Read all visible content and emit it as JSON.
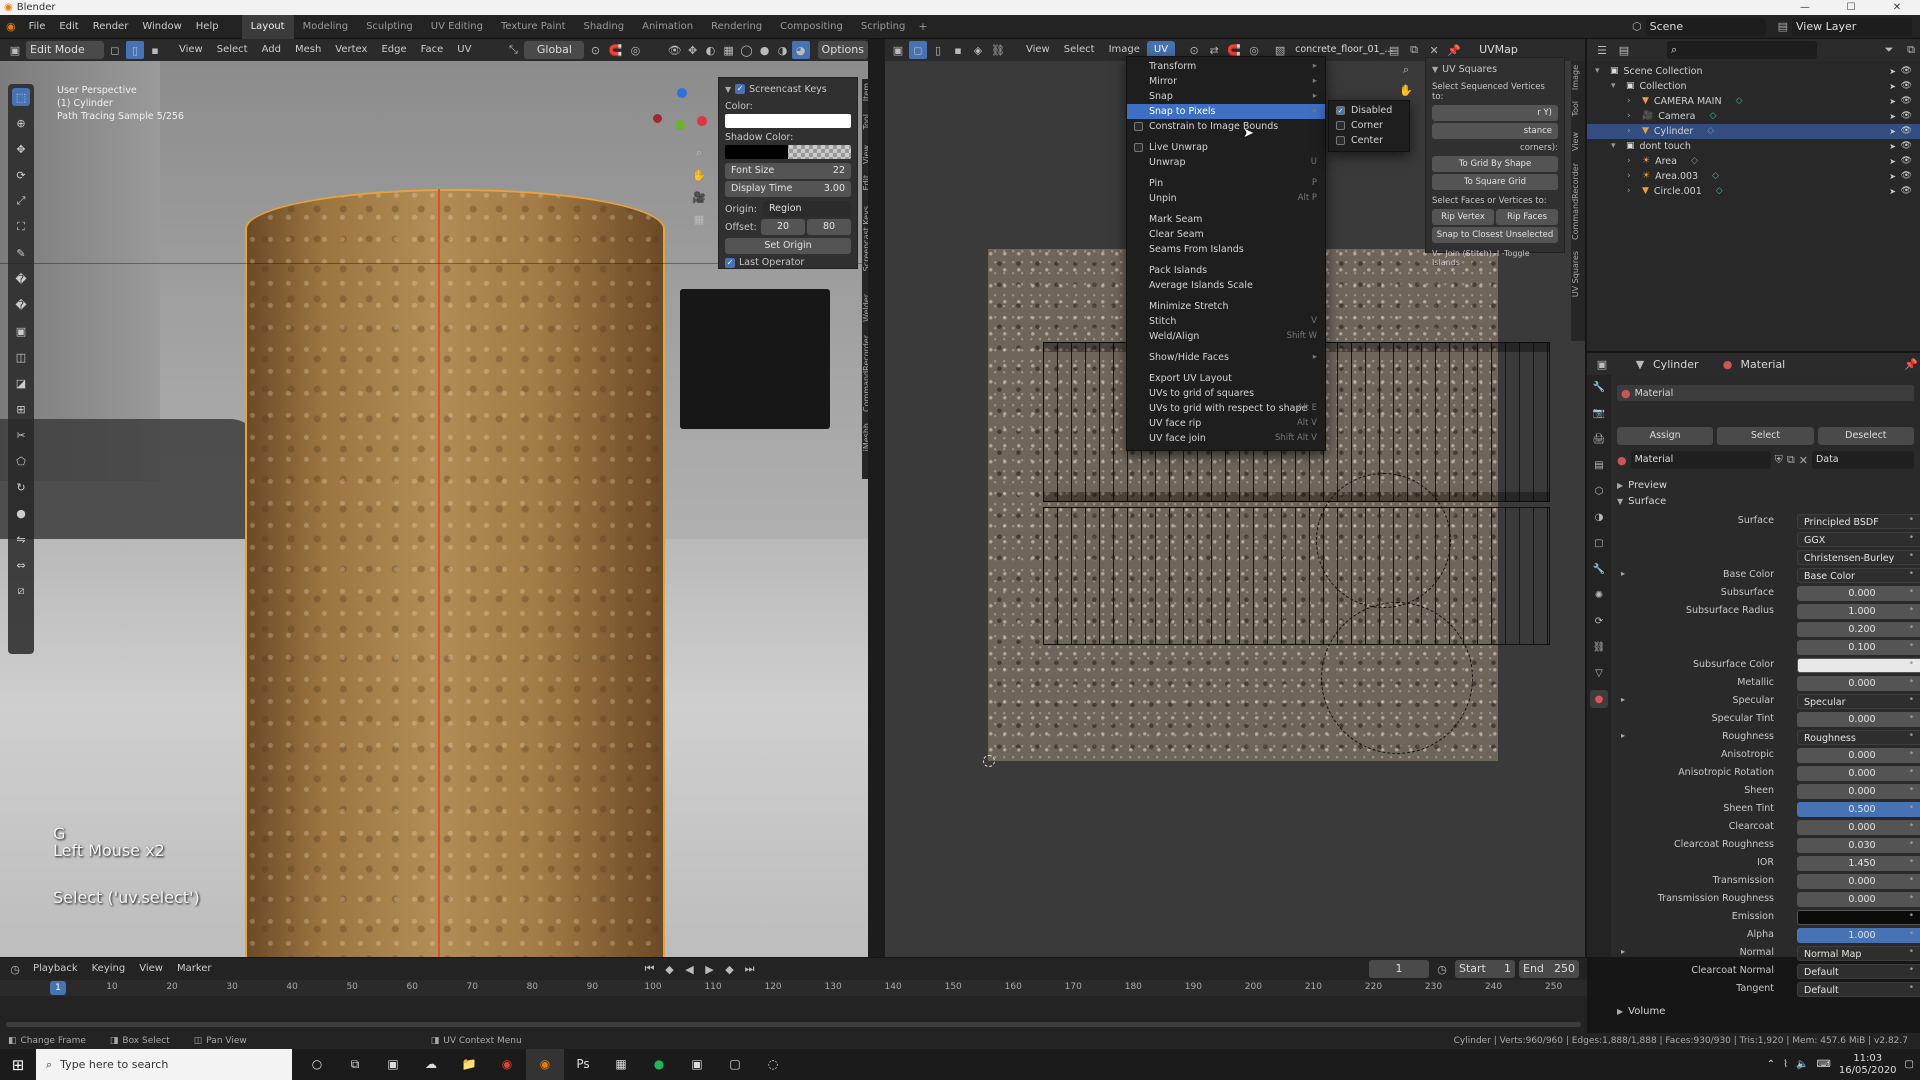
{
  "title_bar": {
    "app": "Blender"
  },
  "top_menu": [
    "File",
    "Edit",
    "Render",
    "Window",
    "Help"
  ],
  "workspaces": [
    "Layout",
    "Modeling",
    "Sculpting",
    "UV Editing",
    "Texture Paint",
    "Shading",
    "Animation",
    "Rendering",
    "Compositing",
    "Scripting"
  ],
  "active_workspace": "Layout",
  "scene": "Scene",
  "view_layer": "View Layer",
  "viewport": {
    "mode": "Edit Mode",
    "menus": [
      "View",
      "Select",
      "Add",
      "Mesh",
      "Vertex",
      "Edge",
      "Face",
      "UV"
    ],
    "orientation": "Global",
    "options_label": "Options",
    "overlay_text": [
      "User Perspective",
      "(1) Cylinder",
      "Path Tracing Sample 5/256"
    ],
    "key_big": "G",
    "key_small": "Left Mouse x2",
    "operator_text": "Select ('uv.select')",
    "side_tabs": [
      "Item",
      "Tool",
      "View",
      "Edit",
      "Screencast Keys",
      "Welder",
      "CommandRecorder",
      "iMeshh"
    ],
    "screencast_panel": {
      "title": "Screencast Keys",
      "color_label": "Color:",
      "shadow_label": "Shadow Color:",
      "font_size_label": "Font Size",
      "font_size_value": "22",
      "display_time_label": "Display Time",
      "display_time_value": "3.00",
      "origin_label": "Origin:",
      "origin_value": "Region",
      "offset_label": "Offset:",
      "offset_x": "20",
      "offset_y": "80",
      "set_origin": "Set Origin",
      "last_operator": "Last Operator"
    }
  },
  "uv_editor": {
    "menus": [
      "View",
      "Select",
      "Image",
      "UV"
    ],
    "image_name": "concrete_floor_01_...",
    "uvmap": "UVMap",
    "side_tabs": [
      "Image",
      "Tool",
      "View",
      "CommandRecorder",
      "UV Squares"
    ],
    "uv_menu": {
      "items": [
        {
          "label": "Transform",
          "shortcut": "",
          "sub": true
        },
        {
          "label": "Mirror",
          "shortcut": "",
          "sub": true
        },
        {
          "label": "Snap",
          "shortcut": "",
          "sub": true
        },
        {
          "label": "Snap to Pixels",
          "shortcut": "",
          "sub": true,
          "hl": true
        },
        {
          "label": "Constrain to Image Bounds",
          "shortcut": "",
          "check": true
        },
        {
          "sep": true
        },
        {
          "label": "Live Unwrap",
          "shortcut": "",
          "check": true
        },
        {
          "label": "Unwrap",
          "shortcut": "U"
        },
        {
          "sep": true
        },
        {
          "label": "Pin",
          "shortcut": "P"
        },
        {
          "label": "Unpin",
          "shortcut": "Alt P"
        },
        {
          "sep": true
        },
        {
          "label": "Mark Seam",
          "shortcut": ""
        },
        {
          "label": "Clear Seam",
          "shortcut": ""
        },
        {
          "label": "Seams From Islands",
          "shortcut": ""
        },
        {
          "sep": true
        },
        {
          "label": "Pack Islands",
          "shortcut": ""
        },
        {
          "label": "Average Islands Scale",
          "shortcut": ""
        },
        {
          "sep": true
        },
        {
          "label": "Minimize Stretch",
          "shortcut": ""
        },
        {
          "label": "Stitch",
          "shortcut": "V"
        },
        {
          "label": "Weld/Align",
          "shortcut": "Shift W"
        },
        {
          "sep": true
        },
        {
          "label": "Show/Hide Faces",
          "shortcut": "",
          "sub": true
        },
        {
          "sep": true
        },
        {
          "label": "Export UV Layout",
          "shortcut": ""
        },
        {
          "label": "UVs to grid of squares",
          "shortcut": ""
        },
        {
          "label": "UVs to grid with respect to shape",
          "shortcut": "Alt E"
        },
        {
          "label": "UV face rip",
          "shortcut": "Alt V"
        },
        {
          "label": "UV face join",
          "shortcut": "Shift Alt V"
        }
      ]
    },
    "snap_submenu": [
      {
        "label": "Disabled",
        "checked": true
      },
      {
        "label": "Corner",
        "checked": false
      },
      {
        "label": "Center",
        "checked": false
      }
    ],
    "uv_squares_panel": {
      "title": "UV Squares",
      "seq_label": "Select Sequenced Vertices to:",
      "seq_partial_1": "r Y)",
      "seq_partial_2": "stance",
      "corners_partial": "corners):",
      "grid_shape": "To Grid By Shape",
      "square_grid": "To Square Grid",
      "faces_label": "Select Faces or Vertices to:",
      "rip_vertex": "Rip Vertex",
      "rip_faces": "Rip Faces",
      "snap_closest": "Snap to Closest Unselected",
      "join_hint": "V - Join (Stitch), I -Toggle Islands"
    }
  },
  "outliner": {
    "rows": [
      {
        "label": "Scene Collection",
        "depth": 0,
        "icon": "box"
      },
      {
        "label": "Collection",
        "depth": 1,
        "icon": "box"
      },
      {
        "label": "CAMERA MAIN",
        "depth": 2,
        "icon": "obj"
      },
      {
        "label": "Camera",
        "depth": 2,
        "icon": "cam"
      },
      {
        "label": "Cylinder",
        "depth": 2,
        "icon": "obj",
        "sel": true
      },
      {
        "label": "dont touch",
        "depth": 1,
        "icon": "box"
      },
      {
        "label": "Area",
        "depth": 2,
        "icon": "light"
      },
      {
        "label": "Area.003",
        "depth": 2,
        "icon": "light"
      },
      {
        "label": "Circle.001",
        "depth": 2,
        "icon": "obj"
      }
    ]
  },
  "properties": {
    "object": "Cylinder",
    "material_tab": "Material",
    "slot": "Material",
    "assign": "Assign",
    "select": "Select",
    "deselect": "Deselect",
    "material_name": "Material",
    "data_label": "Data",
    "preview": "Preview",
    "surface_header": "Surface",
    "rows": [
      {
        "label": "Surface",
        "value": "Principled BSDF",
        "left": true
      },
      {
        "label": "",
        "value": "GGX",
        "left": true
      },
      {
        "label": "",
        "value": "Christensen-Burley",
        "left": true
      },
      {
        "label": "Base Color",
        "value": "Base Color",
        "left": true,
        "exp": true
      },
      {
        "label": "Subsurface",
        "value": "0.000"
      },
      {
        "label": "Subsurface Radius",
        "value": "1.000"
      },
      {
        "label": "",
        "value": "0.200"
      },
      {
        "label": "",
        "value": "0.100"
      },
      {
        "label": "Subsurface Color",
        "value": "",
        "color": "#e8e8e8"
      },
      {
        "label": "Metallic",
        "value": "0.000"
      },
      {
        "label": "Specular",
        "value": "Specular",
        "left": true,
        "exp": true
      },
      {
        "label": "Specular Tint",
        "value": "0.000"
      },
      {
        "label": "Roughness",
        "value": "Roughness",
        "left": true,
        "exp": true
      },
      {
        "label": "Anisotropic",
        "value": "0.000"
      },
      {
        "label": "Anisotropic Rotation",
        "value": "0.000"
      },
      {
        "label": "Sheen",
        "value": "0.000"
      },
      {
        "label": "Sheen Tint",
        "value": "0.500",
        "blue": true
      },
      {
        "label": "Clearcoat",
        "value": "0.000"
      },
      {
        "label": "Clearcoat Roughness",
        "value": "0.030"
      },
      {
        "label": "IOR",
        "value": "1.450"
      },
      {
        "label": "Transmission",
        "value": "0.000"
      },
      {
        "label": "Transmission Roughness",
        "value": "0.000"
      },
      {
        "label": "Emission",
        "value": "",
        "color": "#0a0a0a"
      },
      {
        "label": "Alpha",
        "value": "1.000",
        "blue": true
      },
      {
        "label": "Normal",
        "value": "Normal Map",
        "left": true,
        "exp": true
      },
      {
        "label": "Clearcoat Normal",
        "value": "Default",
        "left": true
      },
      {
        "label": "Tangent",
        "value": "Default",
        "left": true
      }
    ],
    "volume": "Volume"
  },
  "timeline": {
    "menus": [
      "Playback",
      "Keying",
      "View",
      "Marker"
    ],
    "current_frame": "1",
    "start_label": "Start",
    "start": "1",
    "end_label": "End",
    "end": "250",
    "ticks": [
      "1",
      "10",
      "20",
      "30",
      "40",
      "50",
      "60",
      "70",
      "80",
      "90",
      "100",
      "110",
      "120",
      "130",
      "140",
      "150",
      "160",
      "170",
      "180",
      "190",
      "200",
      "210",
      "220",
      "230",
      "240",
      "250"
    ]
  },
  "status_bar": {
    "left": [
      "Change Frame",
      "Box Select",
      "Pan View"
    ],
    "center": "UV Context Menu",
    "right": "Cylinder | Verts:960/960 | Edges:1,888/1,888 | Faces:930/930 | Tris:1,920 | Mem: 457.6 MiB | v2.82.7"
  },
  "taskbar": {
    "search": "Type here to search",
    "time": "11:03",
    "date": "16/05/2020"
  },
  "colors": {
    "accent": "#4772b3",
    "highlight": "#3d6fc3",
    "orange": "#e8a239"
  }
}
